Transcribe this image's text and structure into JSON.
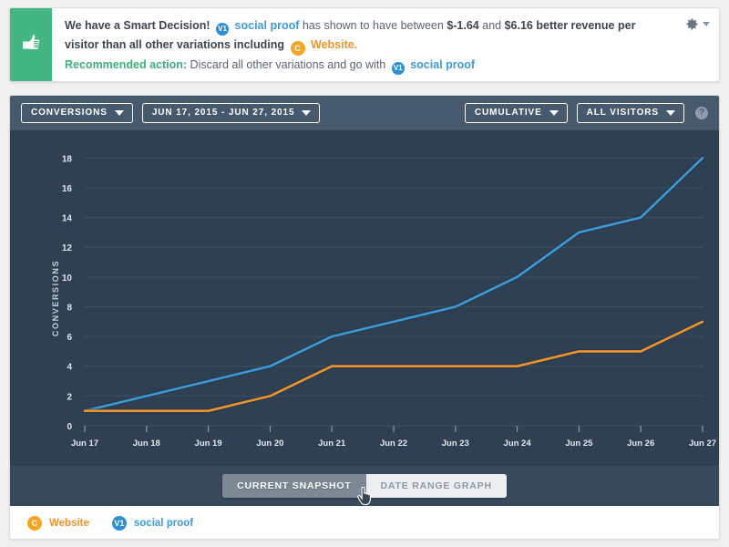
{
  "banner": {
    "icon": "thumbs-up-icon",
    "accent_color": "#44b683",
    "line1_a": "We have a Smart Decision!",
    "badge_v1": "V1",
    "variation_name": "social proof",
    "line1_b": "has shown to have between",
    "low_value": "$-1.64",
    "line1_c": "and",
    "high_value": "$6.16",
    "line1_d": "better revenue per",
    "line2_a": "visitor than all other variations including",
    "badge_c": "C",
    "control_name": "Website.",
    "rec_label": "Recommended action:",
    "rec_text": "Discard all other variations and go with",
    "rec_variation": "social proof",
    "settings_icon": "gear-icon",
    "settings_caret": "chevron-down-icon"
  },
  "toolbar": {
    "metric_label": "CONVERSIONS",
    "date_range_label": "JUN 17, 2015 - JUN 27, 2015",
    "cumulative_label": "CUMULATIVE",
    "visitors_label": "ALL VISITORS",
    "help_label": "?",
    "background": "#47596d"
  },
  "footer": {
    "current_snapshot_label": "CURRENT SNAPSHOT",
    "date_range_graph_label": "DATE RANGE GRAPH",
    "active_tab": "CURRENT SNAPSHOT"
  },
  "legend": {
    "items": [
      {
        "badge": "C",
        "label": "Website",
        "color": "#f0932b"
      },
      {
        "badge": "V1",
        "label": "social proof",
        "color": "#3d9ad6"
      }
    ]
  },
  "chart_data": {
    "type": "line",
    "title": "",
    "xlabel": "",
    "ylabel": "CONVERSIONS",
    "categories": [
      "Jun 17",
      "Jun 18",
      "Jun 19",
      "Jun 20",
      "Jun 21",
      "Jun 22",
      "Jun 23",
      "Jun 24",
      "Jun 25",
      "Jun 26",
      "Jun 27"
    ],
    "yticks": [
      0,
      2,
      4,
      6,
      8,
      10,
      12,
      14,
      16,
      18
    ],
    "ylim": [
      0,
      19
    ],
    "grid": true,
    "legend_position": "below",
    "background": "#2e4052",
    "series": [
      {
        "name": "social proof",
        "badge": "V1",
        "color": "#3d9ad6",
        "values": [
          1,
          2,
          3,
          4,
          6,
          7,
          8,
          10,
          13,
          14,
          18
        ]
      },
      {
        "name": "Website",
        "badge": "C",
        "color": "#f0932b",
        "values": [
          1,
          1,
          1,
          2,
          4,
          4,
          4,
          4,
          5,
          5,
          7
        ]
      }
    ]
  }
}
